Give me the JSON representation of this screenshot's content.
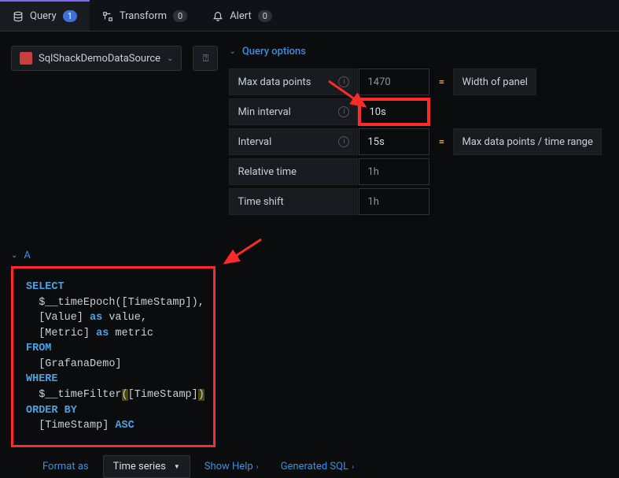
{
  "tabs": {
    "query": {
      "label": "Query",
      "count": "1"
    },
    "transform": {
      "label": "Transform",
      "count": "0"
    },
    "alert": {
      "label": "Alert",
      "count": "0"
    }
  },
  "datasource": {
    "name": "SqlShackDemoDataSource"
  },
  "options": {
    "header": "Query options",
    "max_data_points": {
      "label": "Max data points",
      "placeholder": "1470",
      "desc": "Width of panel"
    },
    "min_interval": {
      "label": "Min interval",
      "value": "10s"
    },
    "interval": {
      "label": "Interval",
      "value": "15s",
      "desc": "Max data points / time range"
    },
    "relative_time": {
      "label": "Relative time",
      "placeholder": "1h"
    },
    "time_shift": {
      "label": "Time shift",
      "placeholder": "1h"
    }
  },
  "query": {
    "ref_id": "A",
    "sql": {
      "l1_kw": "SELECT",
      "l2": "  $__timeEpoch([TimeStamp]),",
      "l3a": "  [Value] ",
      "l3kw": "as",
      "l3b": " value,",
      "l4a": "  [Metric] ",
      "l4kw": "as",
      "l4b": " metric",
      "l5_kw": "FROM",
      "l6": "  [GrafanaDemo]",
      "l7_kw": "WHERE",
      "l8a": "  $__timeFilter",
      "l8p1": "(",
      "l8b": "[TimeStamp]",
      "l8p2": ")",
      "l9_kw": "ORDER BY",
      "l10a": "  [TimeStamp] ",
      "l10kw": "ASC"
    }
  },
  "footer": {
    "format_as": "Format as",
    "format_value": "Time series",
    "show_help": "Show Help",
    "generated_sql": "Generated SQL"
  }
}
